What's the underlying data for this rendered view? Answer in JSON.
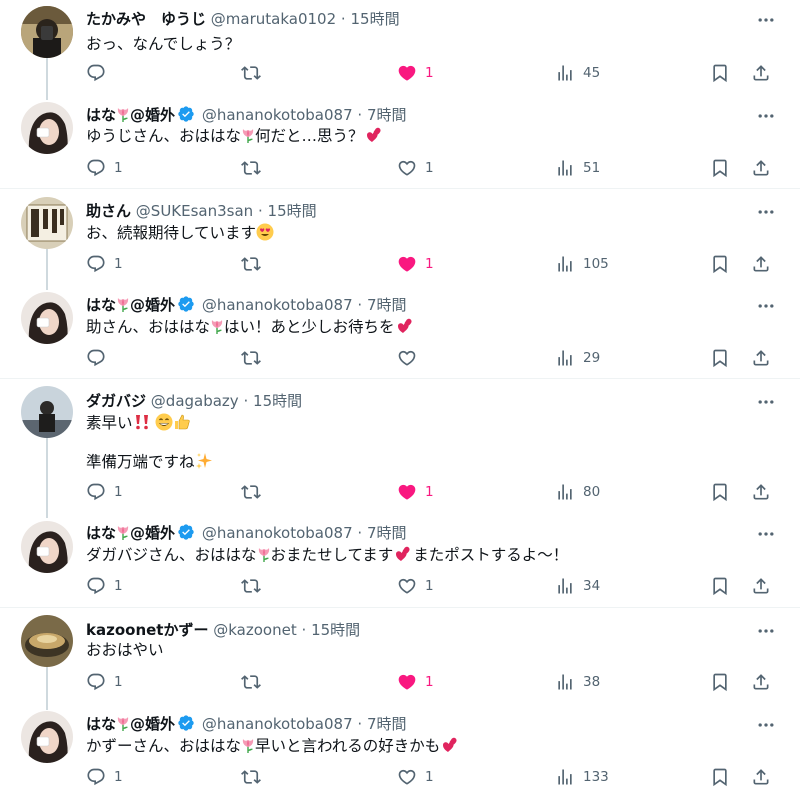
{
  "tweets": [
    {
      "name": "たかみや　ゆうじ",
      "handle": "@marutaka0102",
      "time": "15時間",
      "text1": "おっ、なんでしょう？",
      "reply": "",
      "retweet": "",
      "like": "1",
      "views": "45",
      "liked": true
    },
    {
      "name_a": "はな",
      "name_b": "@婚外",
      "handle": "@hananokotoba087",
      "time": "7時間",
      "text_a": "ゆうじさん、おははな",
      "text_b": "何だと…思う？",
      "reply": "1",
      "retweet": "",
      "like": "1",
      "views": "51",
      "liked": false
    },
    {
      "name": "助さん",
      "handle": "@SUKEsan3san",
      "time": "15時間",
      "text1": "お、続報期待しています",
      "reply": "1",
      "retweet": "",
      "like": "1",
      "views": "105",
      "liked": true
    },
    {
      "name_a": "はな",
      "name_b": "@婚外",
      "handle": "@hananokotoba087",
      "time": "7時間",
      "text_a": "助さん、おははな",
      "text_b": "はい！あと少しお待ちを",
      "reply": "",
      "retweet": "",
      "like": "",
      "views": "29",
      "liked": false
    },
    {
      "name": "ダガバジ",
      "handle": "@dagabazy",
      "time": "15時間",
      "text1": "素早い",
      "text2": "準備万端ですね",
      "reply": "1",
      "retweet": "",
      "like": "1",
      "views": "80",
      "liked": true
    },
    {
      "name_a": "はな",
      "name_b": "@婚外",
      "handle": "@hananokotoba087",
      "time": "7時間",
      "text_a": "ダガバジさん、おははな",
      "text_b": "おまたせしてます",
      "text_c": "またポストするよ～！",
      "reply": "1",
      "retweet": "",
      "like": "1",
      "views": "34",
      "liked": false
    },
    {
      "name": "kazoonetかずー",
      "handle": "@kazoonet",
      "time": "15時間",
      "text1": "おおはやい",
      "reply": "1",
      "retweet": "",
      "like": "1",
      "views": "38",
      "liked": true
    },
    {
      "name_a": "はな",
      "name_b": "@婚外",
      "handle": "@hananokotoba087",
      "time": "7時間",
      "text_a": "かずーさん、おははな",
      "text_b": "早いと言われるの好きかも",
      "reply": "1",
      "retweet": "",
      "like": "1",
      "views": "133",
      "liked": false
    }
  ],
  "dot": "·",
  "colors": {
    "like_active": "#f91880",
    "muted": "#536471",
    "verified": "#1d9bf0",
    "thread_line": "#cfd9de"
  }
}
